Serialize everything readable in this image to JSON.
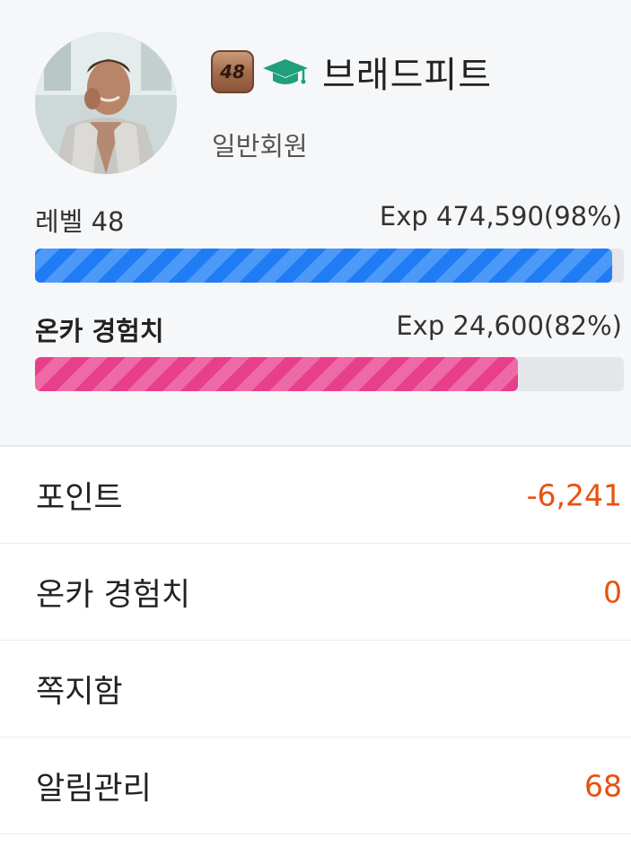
{
  "profile": {
    "level_badge": "48",
    "graduate_icon": "graduation-cap-icon",
    "name": "브래드피트",
    "member_type": "일반회원"
  },
  "level_bar": {
    "label": "레벨 48",
    "value_text": "Exp 474,590(98%)",
    "progress_percent": 98,
    "color": "#1f7cf5"
  },
  "onca_bar": {
    "label": "온카 경험치",
    "value_text": "Exp 24,600(82%)",
    "progress_percent": 82,
    "color": "#e83f8c"
  },
  "menu": [
    {
      "label": "포인트",
      "value": "-6,241"
    },
    {
      "label": "온카 경험치",
      "value": "0"
    },
    {
      "label": "쪽지함",
      "value": ""
    },
    {
      "label": "알림관리",
      "value": "68"
    }
  ],
  "colors": {
    "accent_orange": "#e8520e",
    "icon_green": "#1fa07a"
  }
}
